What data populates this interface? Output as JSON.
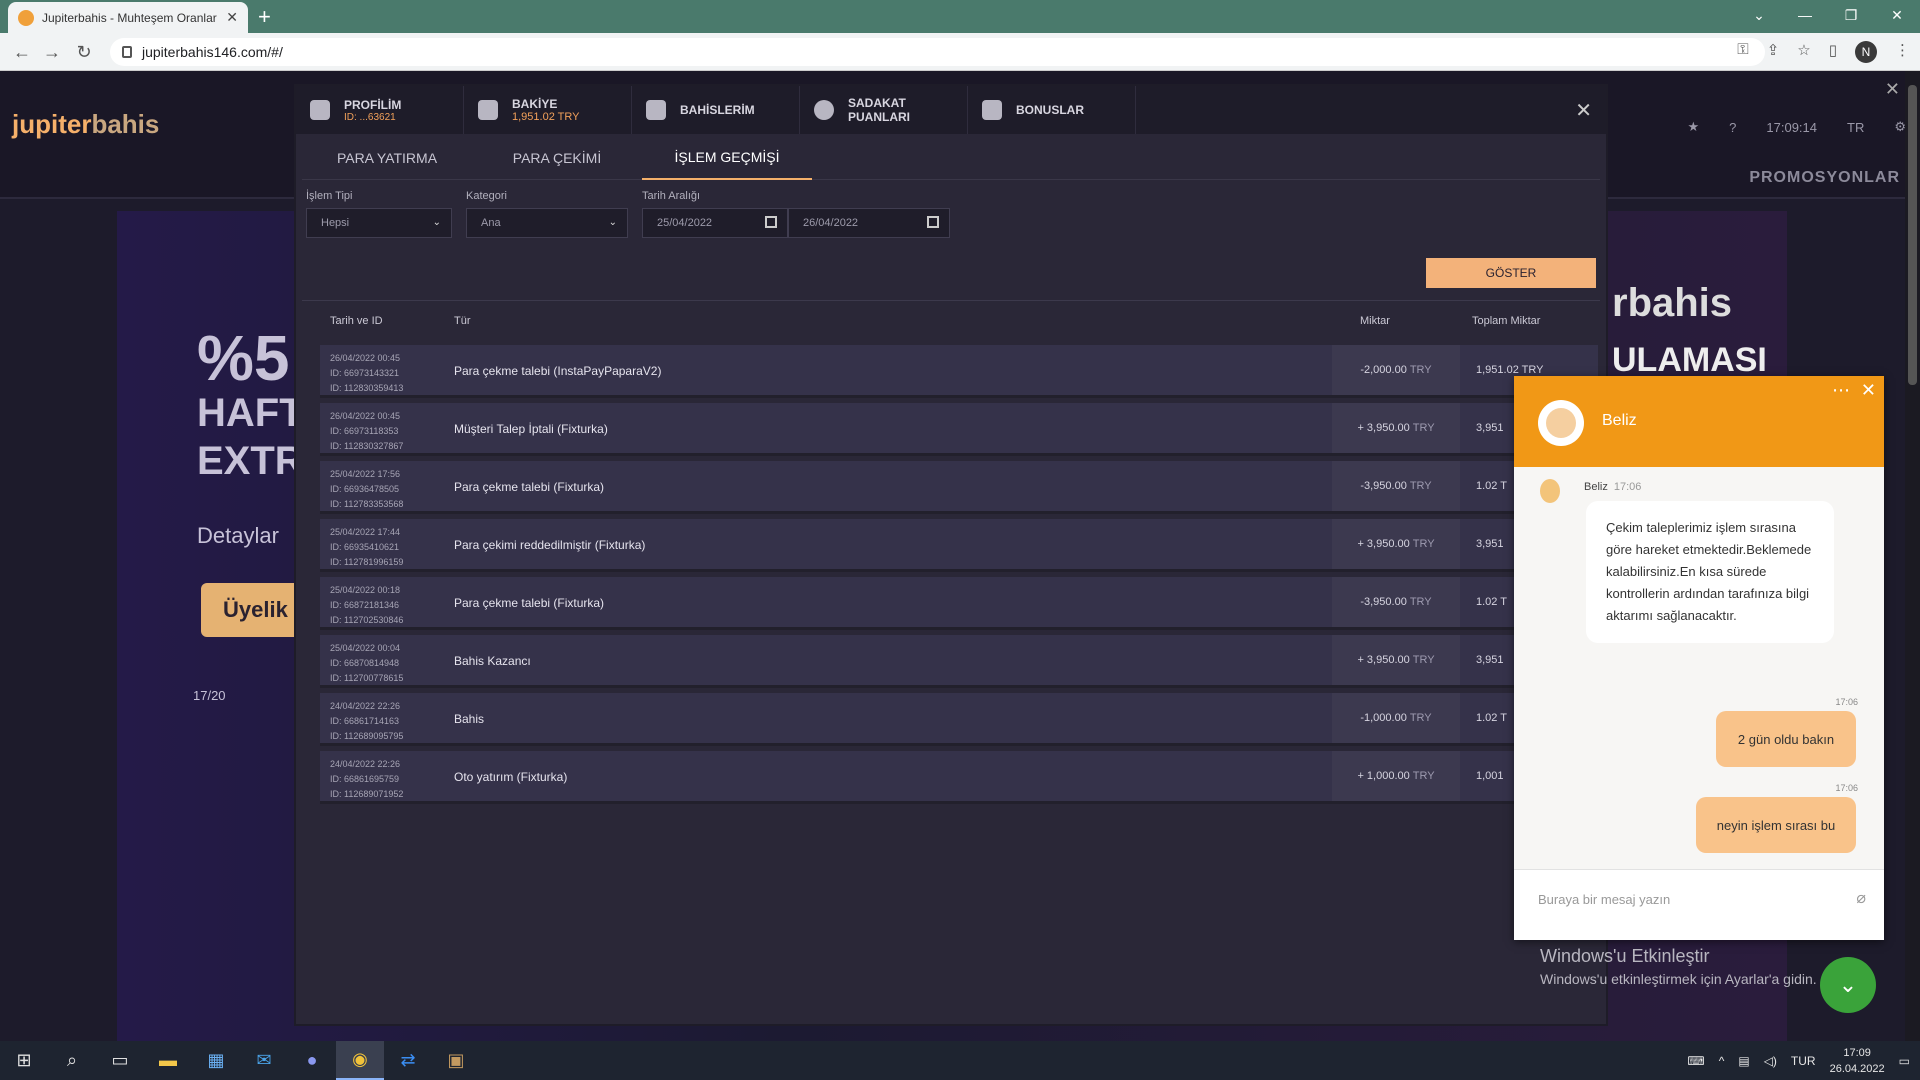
{
  "browser": {
    "tab_title": "Jupiterbahis - Muhteşem Oranlar",
    "url": "jupiterbahis146.com/#/",
    "profile_initial": "N"
  },
  "site": {
    "logo_brand_a": "jupiter",
    "logo_brand_b": "bahis",
    "time": "17:09:14",
    "lang": "TR",
    "promos": "PROMOSYONLAR",
    "banner_lines": [
      "%5",
      "HAFT",
      "EXTR",
      "Detaylar",
      "Üyelik"
    ],
    "carousel_counter": "17/20",
    "banner_right_brand": "rbahis",
    "banner_right_sub": "ULAMASI"
  },
  "modal": {
    "tabs": [
      {
        "label": "PROFİLİM",
        "sub": "ID: ...63621"
      },
      {
        "label": "BAKİYE",
        "sub": "1,951.02 TRY"
      },
      {
        "label": "BAHİSLERİM"
      },
      {
        "label": "SADAKAT PUANLARI"
      },
      {
        "label": "BONUSLAR"
      }
    ],
    "subtabs": [
      "PARA YATIRMA",
      "PARA ÇEKİMİ",
      "İŞLEM GEÇMİŞİ"
    ],
    "filters": {
      "type_label": "İşlem Tipi",
      "type_value": "Hepsi",
      "category_label": "Kategori",
      "category_value": "Ana",
      "date_label": "Tarih Aralığı",
      "date_from": "25/04/2022",
      "date_to": "26/04/2022"
    },
    "show_button": "GÖSTER",
    "columns": [
      "Tarih ve ID",
      "Tür",
      "Miktar",
      "Toplam Miktar"
    ],
    "rows": [
      {
        "date": "26/04/2022 00:45",
        "id1": "ID: 66973143321",
        "id2": "ID: 112830359413",
        "type": "Para çekme talebi (InstaPayPaparaV2)",
        "amount": "-2,000.00",
        "cur": "TRY",
        "total": "1,951.02 TRY"
      },
      {
        "date": "26/04/2022 00:45",
        "id1": "ID: 66973118353",
        "id2": "ID: 112830327867",
        "type": "Müşteri Talep İptali (Fixturka)",
        "amount": "+ 3,950.00",
        "cur": "TRY",
        "total": "3,951"
      },
      {
        "date": "25/04/2022 17:56",
        "id1": "ID: 66936478505",
        "id2": "ID: 112783353568",
        "type": "Para çekme talebi (Fixturka)",
        "amount": "-3,950.00",
        "cur": "TRY",
        "total": "1.02 T"
      },
      {
        "date": "25/04/2022 17:44",
        "id1": "ID: 66935410621",
        "id2": "ID: 112781996159",
        "type": "Para çekimi reddedilmiştir (Fixturka)",
        "amount": "+ 3,950.00",
        "cur": "TRY",
        "total": "3,951"
      },
      {
        "date": "25/04/2022 00:18",
        "id1": "ID: 66872181346",
        "id2": "ID: 112702530846",
        "type": "Para çekme talebi (Fixturka)",
        "amount": "-3,950.00",
        "cur": "TRY",
        "total": "1.02 T"
      },
      {
        "date": "25/04/2022 00:04",
        "id1": "ID: 66870814948",
        "id2": "ID: 112700778615",
        "type": "Bahis Kazancı",
        "amount": "+ 3,950.00",
        "cur": "TRY",
        "total": "3,951"
      },
      {
        "date": "24/04/2022 22:26",
        "id1": "ID: 66861714163",
        "id2": "ID: 112689095795",
        "type": "Bahis",
        "amount": "-1,000.00",
        "cur": "TRY",
        "total": "1.02 T"
      },
      {
        "date": "24/04/2022 22:26",
        "id1": "ID: 66861695759",
        "id2": "ID: 112689071952",
        "type": "Oto yatırım (Fixturka)",
        "amount": "+ 1,000.00",
        "cur": "TRY",
        "total": "1,001"
      }
    ]
  },
  "chat": {
    "agent": "Beliz",
    "agent_time": "17:06",
    "agent_msg": "Çekim taleplerimiz işlem sırasına göre hareket etmektedir.Beklemede kalabilirsiniz.En kısa sürede kontrollerin ardından tarafınıza bilgi aktarımı sağlanacaktır.",
    "msg1_time": "17:06",
    "msg1": "2 gün oldu bakın",
    "msg2_time": "17:06",
    "msg2": "neyin işlem sırası bu",
    "input_placeholder": "Buraya bir mesaj yazın"
  },
  "watermark": {
    "line1": "Windows'u Etkinleştir",
    "line2": "Windows'u etkinleştirmek için Ayarlar'a gidin."
  },
  "taskbar": {
    "lang": "TUR",
    "time": "17:09",
    "date": "26.04.2022"
  }
}
